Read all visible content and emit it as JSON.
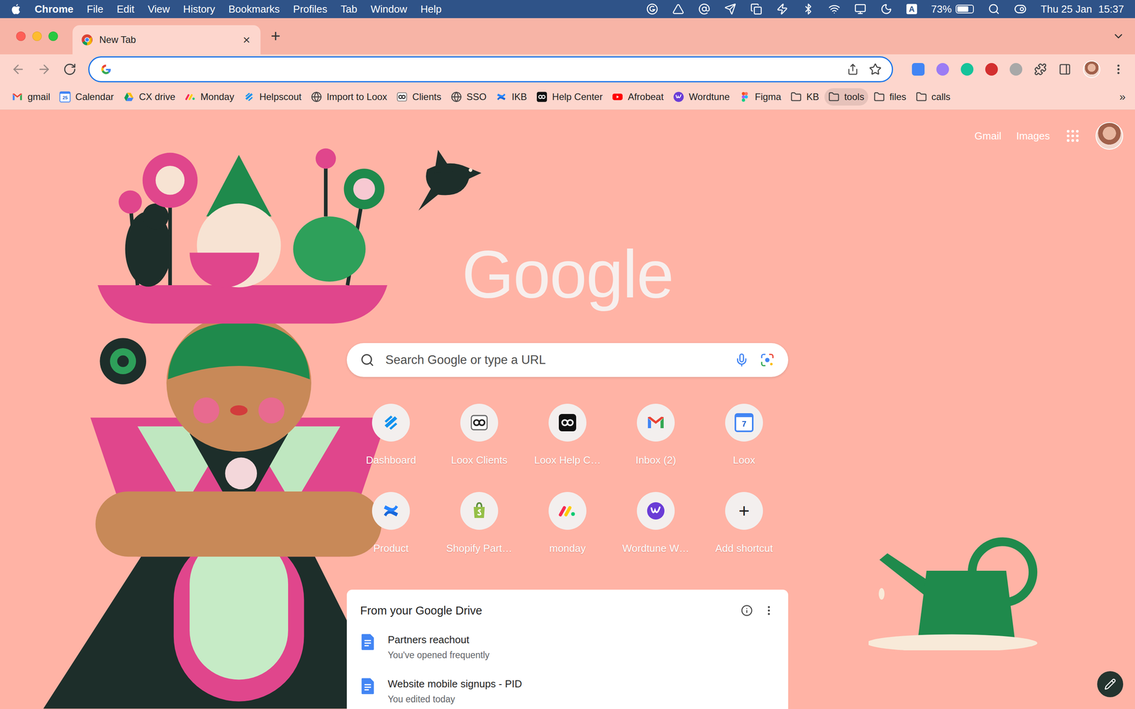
{
  "menubar": {
    "app": "Chrome",
    "menus": [
      "File",
      "Edit",
      "View",
      "History",
      "Bookmarks",
      "Profiles",
      "Tab",
      "Window",
      "Help"
    ],
    "input_source": "A",
    "battery": "73%",
    "battery_level": 0.73,
    "date": "Thu 25 Jan",
    "time": "15:37"
  },
  "tabs": [
    {
      "label": "New Tab",
      "selected": true,
      "close": "×"
    }
  ],
  "new_tab": "+",
  "omnibox": {
    "value": "",
    "focused": true
  },
  "bookmarks": {
    "items": [
      {
        "label": "gmail",
        "kind": "gmail",
        "selected": false
      },
      {
        "label": "Calendar",
        "kind": "calendar",
        "badge": "25",
        "selected": false
      },
      {
        "label": "CX drive",
        "kind": "drive",
        "selected": false
      },
      {
        "label": "Monday",
        "kind": "monday",
        "selected": false
      },
      {
        "label": "Helpscout",
        "kind": "helpscout",
        "selected": false
      },
      {
        "label": "Import to Loox",
        "kind": "globe",
        "selected": false
      },
      {
        "label": "Clients",
        "kind": "loox",
        "selected": false
      },
      {
        "label": "SSO",
        "kind": "globe",
        "selected": false
      },
      {
        "label": "IKB",
        "kind": "confluence",
        "selected": false
      },
      {
        "label": "Help Center",
        "kind": "loox-dark",
        "selected": false
      },
      {
        "label": "Afrobeat",
        "kind": "youtube",
        "selected": false
      },
      {
        "label": "Wordtune",
        "kind": "wordtune",
        "selected": false
      },
      {
        "label": "Figma",
        "kind": "figma",
        "selected": false
      },
      {
        "label": "KB",
        "kind": "folder",
        "selected": false
      },
      {
        "label": "tools",
        "kind": "folder",
        "selected": true
      },
      {
        "label": "files",
        "kind": "folder",
        "selected": false
      },
      {
        "label": "calls",
        "kind": "folder",
        "selected": false
      }
    ],
    "more": "»"
  },
  "ntp": {
    "links": [
      "Gmail",
      "Images"
    ],
    "logo": "Google",
    "search_placeholder": "Search Google or type a URL",
    "shortcuts": [
      {
        "label": "Dashboard",
        "kind": "helpscout"
      },
      {
        "label": "Loox Clients",
        "kind": "loox"
      },
      {
        "label": "Loox Help C…",
        "kind": "loox-dark"
      },
      {
        "label": "Inbox (2)",
        "kind": "gmail"
      },
      {
        "label": "Loox",
        "kind": "calendar",
        "badge": "7"
      },
      {
        "label": "Product",
        "kind": "confluence"
      },
      {
        "label": "Shopify Part…",
        "kind": "shopify"
      },
      {
        "label": "monday",
        "kind": "monday"
      },
      {
        "label": "Wordtune W…",
        "kind": "wordtune"
      },
      {
        "label": "Add shortcut",
        "kind": "add",
        "glyph": "+"
      }
    ],
    "drive": {
      "title": "From your Google Drive",
      "items": [
        {
          "title": "Partners reachout",
          "reason": "You've opened frequently"
        },
        {
          "title": "Website mobile signups - PID",
          "reason": "You edited today"
        }
      ]
    }
  }
}
